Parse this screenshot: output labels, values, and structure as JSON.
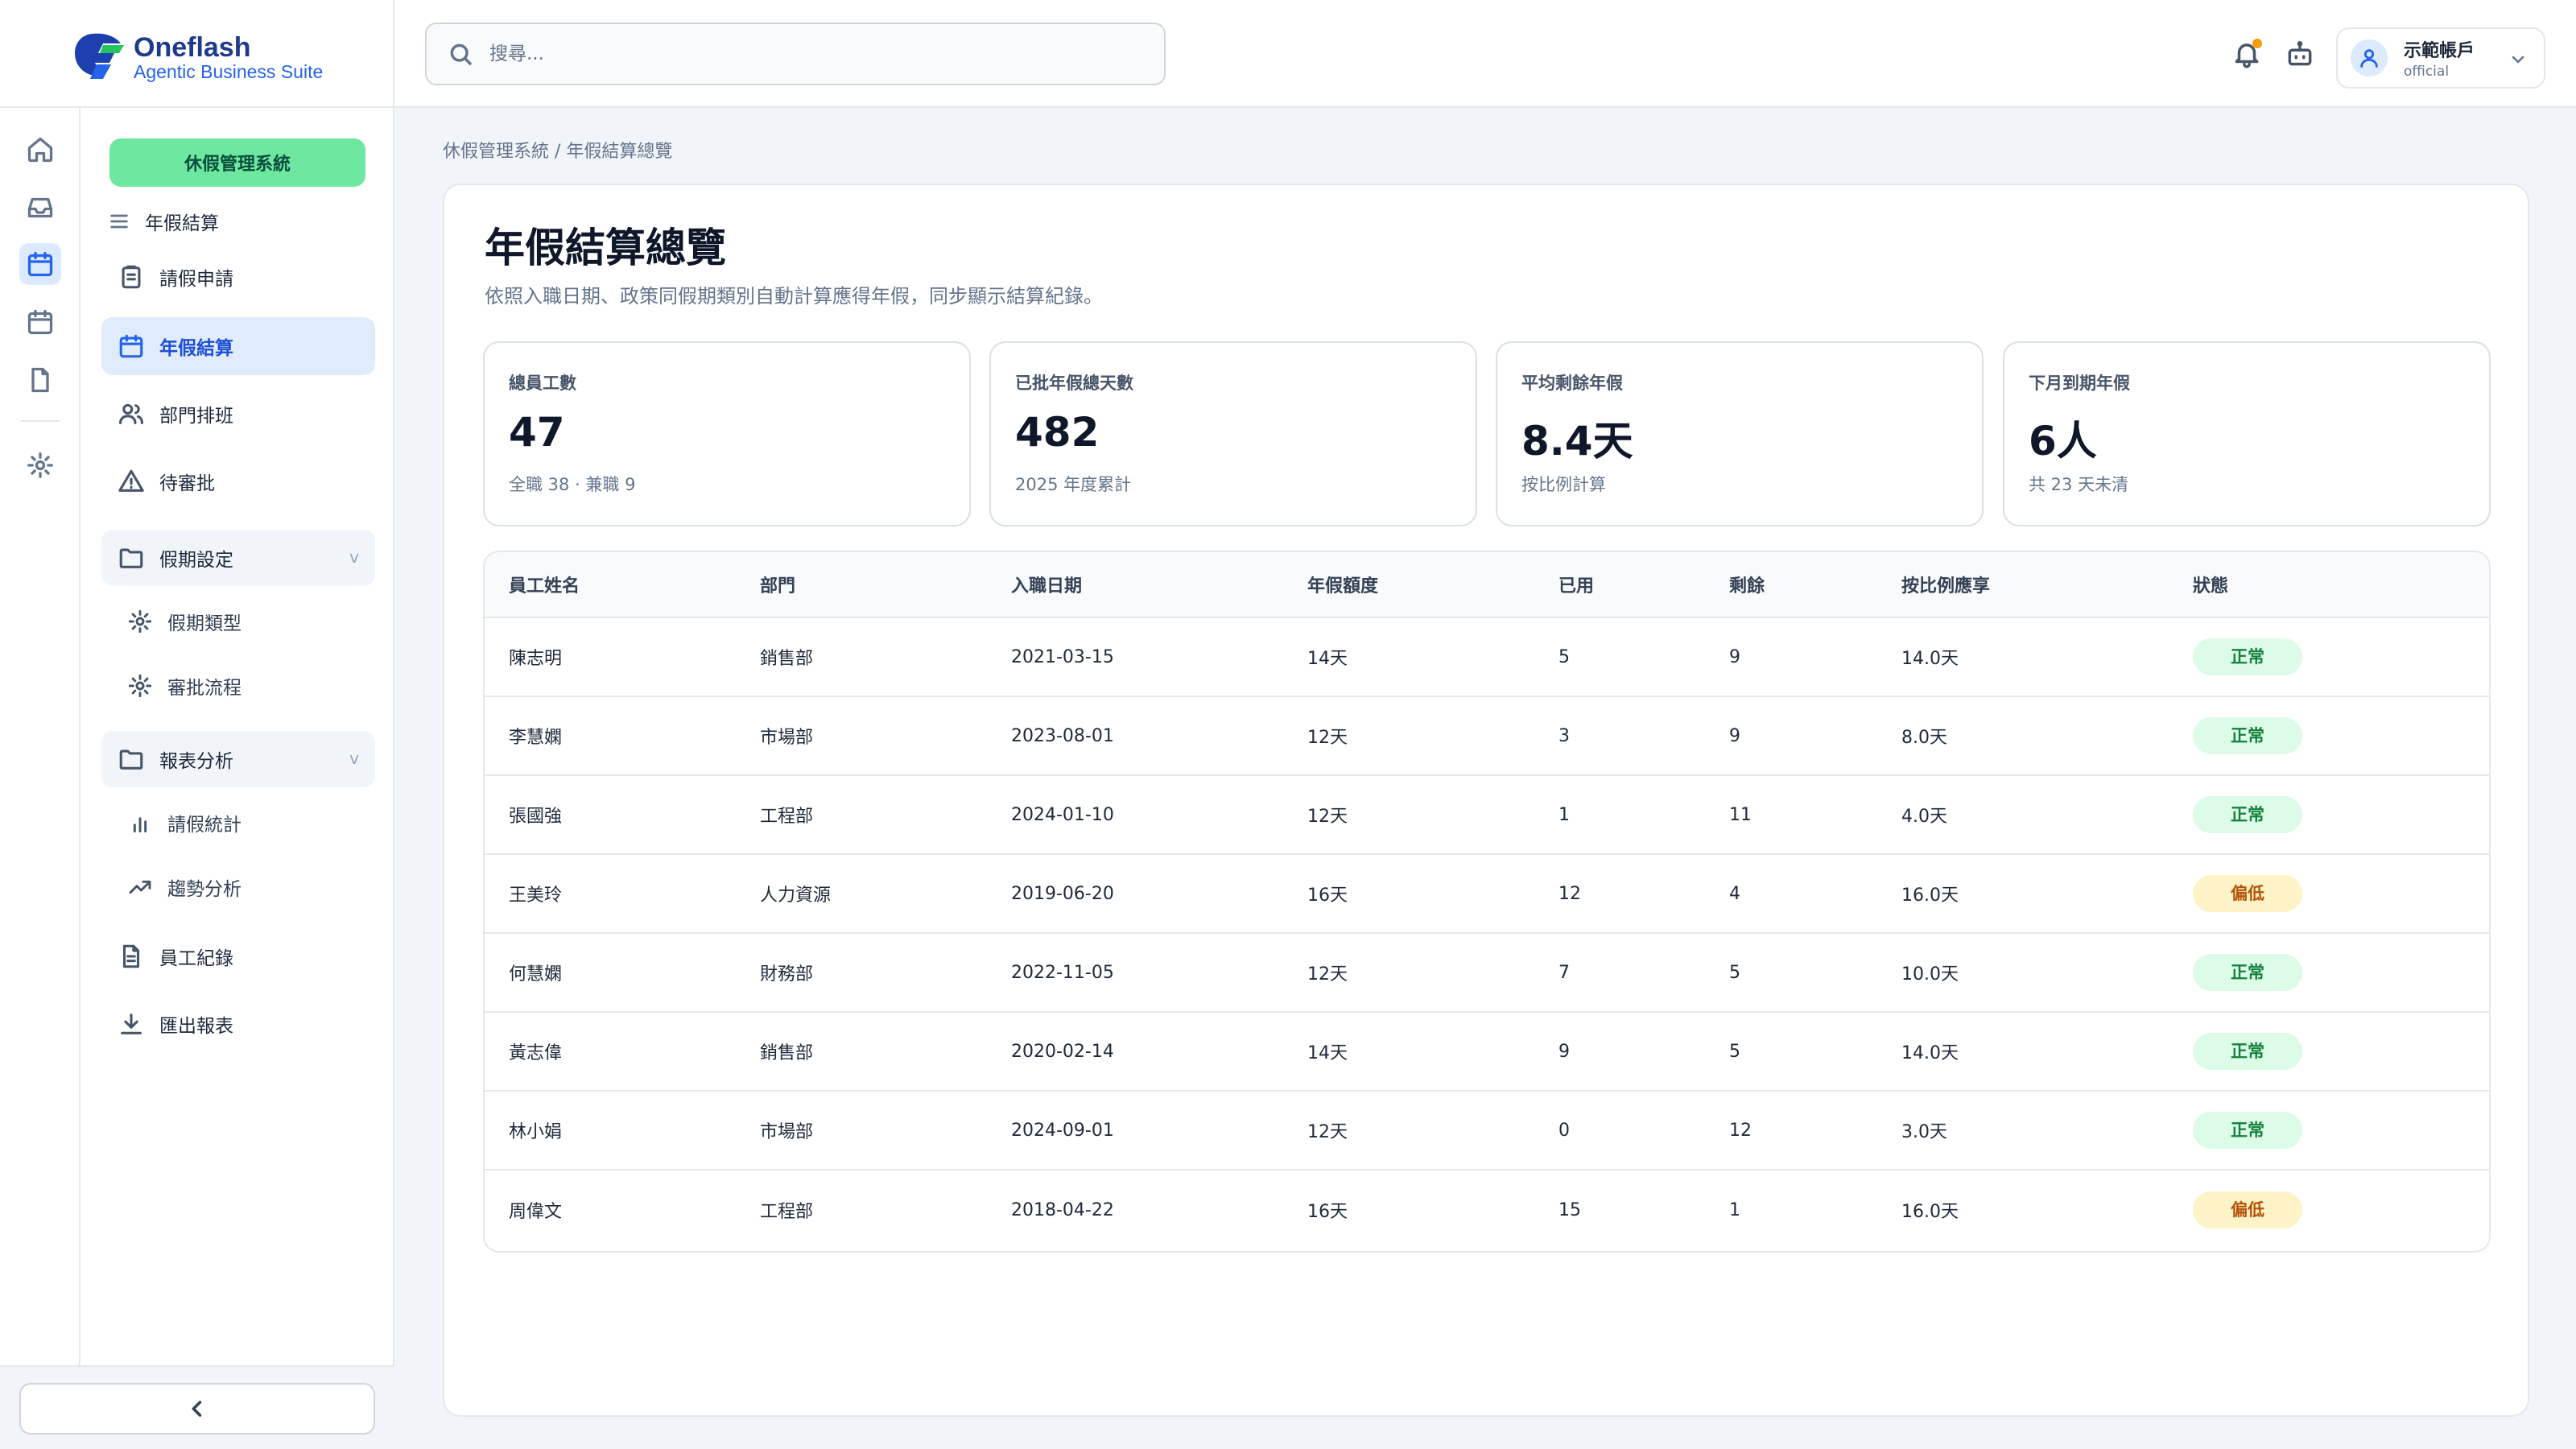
{
  "brand": {
    "name": "Oneflash",
    "tagline": "Agentic Business Suite"
  },
  "search": {
    "placeholder": "搜尋..."
  },
  "account": {
    "name": "示範帳戶",
    "role": "official"
  },
  "sidebar": {
    "system_label": "休假管理系統",
    "section_label": "年假結算",
    "items": [
      {
        "label": "請假申請"
      },
      {
        "label": "年假結算"
      },
      {
        "label": "部門排班"
      },
      {
        "label": "待審批"
      }
    ],
    "groups": [
      {
        "label": "假期設定",
        "caret": "v",
        "children": [
          {
            "label": "假期類型"
          },
          {
            "label": "審批流程"
          }
        ]
      },
      {
        "label": "報表分析",
        "caret": "v",
        "children": [
          {
            "label": "請假統計"
          },
          {
            "label": "趨勢分析"
          }
        ]
      }
    ],
    "bottom_items": [
      {
        "label": "員工紀錄"
      },
      {
        "label": "匯出報表"
      }
    ]
  },
  "breadcrumb": "休假管理系統 / 年假結算總覽",
  "page": {
    "title": "年假結算總覽",
    "description": "依照入職日期、政策同假期類別自動計算應得年假，同步顯示結算紀錄。"
  },
  "stats": [
    {
      "label": "總員工數",
      "value": "47",
      "note": "全職 38 · 兼職 9"
    },
    {
      "label": "已批年假總天數",
      "value": "482",
      "note": "2025 年度累計"
    },
    {
      "label": "平均剩餘年假",
      "value": "8.4天",
      "note": "按比例計算"
    },
    {
      "label": "下月到期年假",
      "value": "6人",
      "note": "共 23 天未清"
    }
  ],
  "table": {
    "headers": [
      "員工姓名",
      "部門",
      "入職日期",
      "年假額度",
      "已用",
      "剩餘",
      "按比例應享",
      "狀態"
    ],
    "rows": [
      {
        "name": "陳志明",
        "dept": "銷售部",
        "hire_date": "2021-03-15",
        "quota": "14天",
        "used": "5",
        "remaining": "9",
        "prorated": "14.0天",
        "status": "正常",
        "status_type": "ok"
      },
      {
        "name": "李慧嫻",
        "dept": "市場部",
        "hire_date": "2023-08-01",
        "quota": "12天",
        "used": "3",
        "remaining": "9",
        "prorated": "8.0天",
        "status": "正常",
        "status_type": "ok"
      },
      {
        "name": "張國強",
        "dept": "工程部",
        "hire_date": "2024-01-10",
        "quota": "12天",
        "used": "1",
        "remaining": "11",
        "prorated": "4.0天",
        "status": "正常",
        "status_type": "ok"
      },
      {
        "name": "王美玲",
        "dept": "人力資源",
        "hire_date": "2019-06-20",
        "quota": "16天",
        "used": "12",
        "remaining": "4",
        "prorated": "16.0天",
        "status": "偏低",
        "status_type": "low"
      },
      {
        "name": "何慧嫻",
        "dept": "財務部",
        "hire_date": "2022-11-05",
        "quota": "12天",
        "used": "7",
        "remaining": "5",
        "prorated": "10.0天",
        "status": "正常",
        "status_type": "ok"
      },
      {
        "name": "黃志偉",
        "dept": "銷售部",
        "hire_date": "2020-02-14",
        "quota": "14天",
        "used": "9",
        "remaining": "5",
        "prorated": "14.0天",
        "status": "正常",
        "status_type": "ok"
      },
      {
        "name": "林小娟",
        "dept": "市場部",
        "hire_date": "2024-09-01",
        "quota": "12天",
        "used": "0",
        "remaining": "12",
        "prorated": "3.0天",
        "status": "正常",
        "status_type": "ok"
      },
      {
        "name": "周偉文",
        "dept": "工程部",
        "hire_date": "2018-04-22",
        "quota": "16天",
        "used": "15",
        "remaining": "1",
        "prorated": "16.0天",
        "status": "偏低",
        "status_type": "low"
      }
    ]
  },
  "colors": {
    "accent": "#2563eb",
    "pill": "#6ee7a0",
    "ok": "#15803d",
    "low": "#b45309"
  }
}
